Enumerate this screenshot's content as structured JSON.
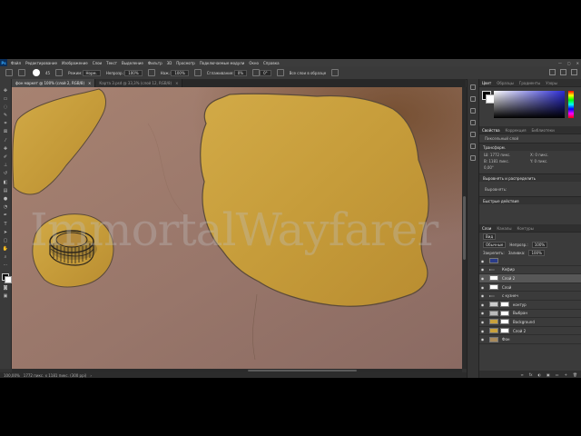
{
  "app": {
    "logo": "Ps"
  },
  "menu": [
    "Файл",
    "Редактирование",
    "Изображение",
    "Слои",
    "Текст",
    "Выделение",
    "Фильтр",
    "3D",
    "Просмотр",
    "Подключаемые модули",
    "Окно",
    "Справка"
  ],
  "window_controls": [
    "—",
    "▢",
    "✕"
  ],
  "options": {
    "brush_size": "45",
    "mode_label": "Режим:",
    "mode_value": "Норм.",
    "opacity_label": "Непрозр.:",
    "opacity_value": "100%",
    "flow_label": "Наж.:",
    "flow_value": "100%",
    "smoothing_label": "Сглаживание:",
    "smoothing_value": "0%",
    "angle_value": "0°",
    "sample_label": "Все слои в образце"
  },
  "tabs": [
    {
      "label": "фон маркет @ 100% (слой 2, RGB/8)",
      "close": "×",
      "active": true
    },
    {
      "label": "Карта 3.psd @ 33,3% (слой 12, RGB/8)",
      "close": "×",
      "active": false
    }
  ],
  "status": {
    "zoom": "100,00%",
    "doc": "1772 пикс. x 1181 пикс. (300 ppi)",
    "arrow": "›"
  },
  "color_panel": {
    "tabs": [
      "Цвет",
      "Образцы",
      "Градиенты",
      "Узоры"
    ]
  },
  "properties": {
    "tabs": [
      "Свойства",
      "Коррекция",
      "Библиотеки"
    ],
    "layer_type": "Пиксельный слой",
    "transform_title": "Трансформ.",
    "w": "Ш: 1772 пикс.",
    "h": "В: 1181 пикс.",
    "x": "X: 0 пикс.",
    "y": "Y: 0 пикс.",
    "angle": "0,00°",
    "align_title": "Выровнять и распределить",
    "align_sub": "Выровнять:",
    "quick_title": "Быстрые действия"
  },
  "layers_panel": {
    "tabs": [
      "Слои",
      "Каналы",
      "Контуры"
    ],
    "kind_label": "Вид",
    "blend_value": "Обычные",
    "opacity_label": "Непрозр.:",
    "opacity_value": "100%",
    "lock_label": "Закрепить:",
    "fill_label": "Заливка:",
    "fill_value": "100%",
    "layers": [
      {
        "name": "",
        "visible": true,
        "kind": "image",
        "selected": false
      },
      {
        "name": "Кефир",
        "visible": true,
        "kind": "folder",
        "selected": false
      },
      {
        "name": "Слой 2",
        "visible": true,
        "kind": "pixel",
        "selected": true
      },
      {
        "name": "Слой",
        "visible": true,
        "kind": "pixel",
        "selected": false
      },
      {
        "name": "с кузнеч",
        "visible": true,
        "kind": "folder",
        "selected": false
      },
      {
        "name": "контур",
        "visible": true,
        "kind": "mask",
        "selected": false
      },
      {
        "name": "Выбран",
        "visible": true,
        "kind": "mask",
        "selected": false
      },
      {
        "name": "Background",
        "visible": true,
        "kind": "mask",
        "selected": false
      },
      {
        "name": "Слой 2",
        "visible": true,
        "kind": "mask",
        "selected": false
      },
      {
        "name": "Фон",
        "visible": true,
        "kind": "pixel",
        "selected": false
      }
    ],
    "bottom_icons": [
      "fx",
      "◐",
      "▣",
      "▭",
      "+",
      "🗑"
    ]
  },
  "watermark": "ImmortalWayfarer",
  "colors": {
    "canvas_bg": "#9a7669",
    "parchment": "#c9a13c",
    "hue_selected": "#2b2bd4"
  }
}
